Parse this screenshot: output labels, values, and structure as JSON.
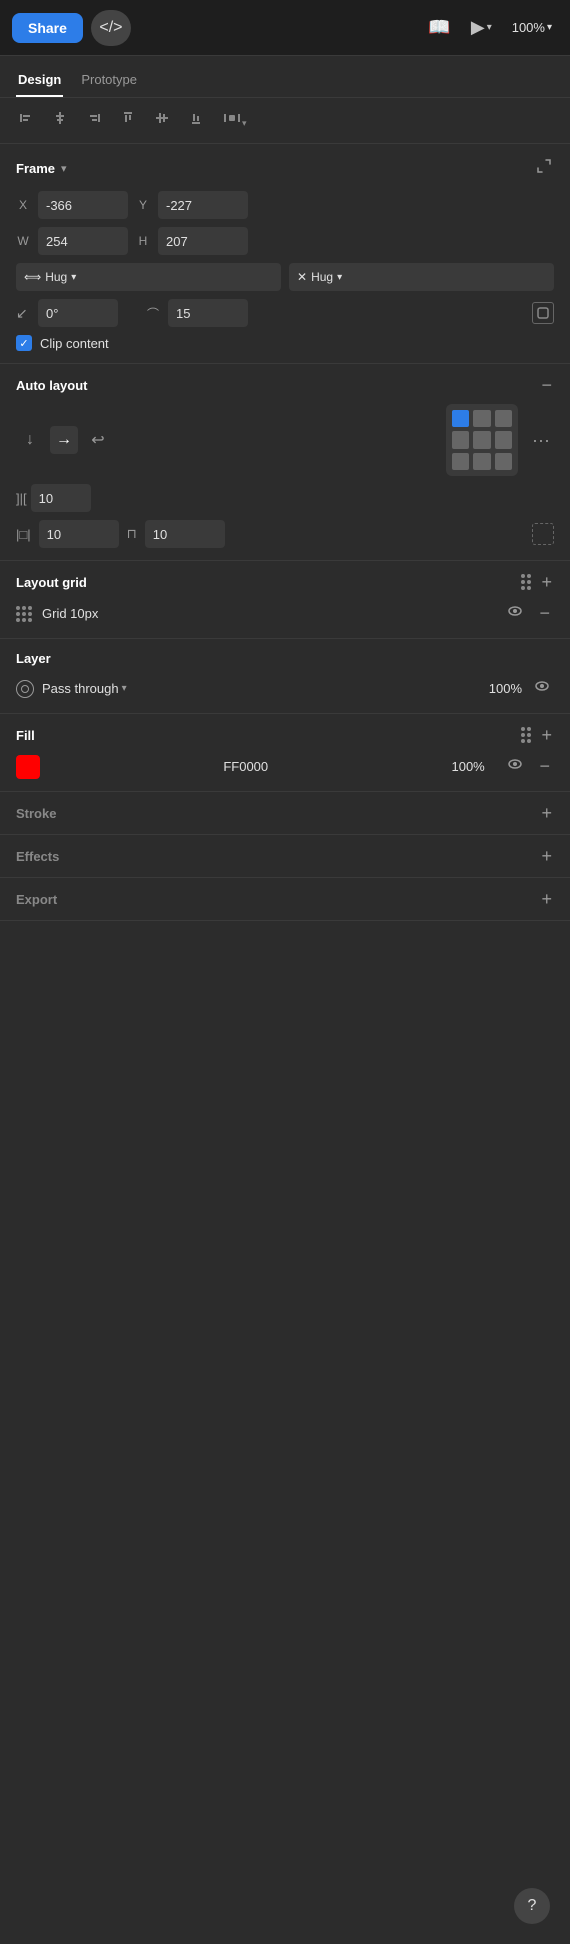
{
  "topbar": {
    "share_label": "Share",
    "code_icon": "</>",
    "zoom_label": "100%"
  },
  "tabs": {
    "design_label": "Design",
    "prototype_label": "Prototype"
  },
  "frame": {
    "title": "Frame",
    "x_label": "X",
    "x_value": "-366",
    "y_label": "Y",
    "y_value": "-227",
    "w_label": "W",
    "w_value": "254",
    "h_label": "H",
    "h_value": "207",
    "hug_x_label": "Hug",
    "hug_y_label": "Hug",
    "angle_label": "0°",
    "corner_label": "15",
    "clip_label": "Clip content"
  },
  "auto_layout": {
    "title": "Auto layout",
    "spacing_label": "10",
    "pad_top_label": "10",
    "pad_right_label": "10",
    "pad_bottom_label": "10"
  },
  "layout_grid": {
    "title": "Layout grid",
    "grid_label": "Grid 10px"
  },
  "layer": {
    "title": "Layer",
    "blend_mode": "Pass through",
    "opacity": "100%"
  },
  "fill": {
    "title": "Fill",
    "color": "#FF0000",
    "hex": "FF0000",
    "opacity": "100%"
  },
  "stroke": {
    "title": "Stroke"
  },
  "effects": {
    "title": "Effects"
  },
  "export": {
    "title": "Export"
  }
}
